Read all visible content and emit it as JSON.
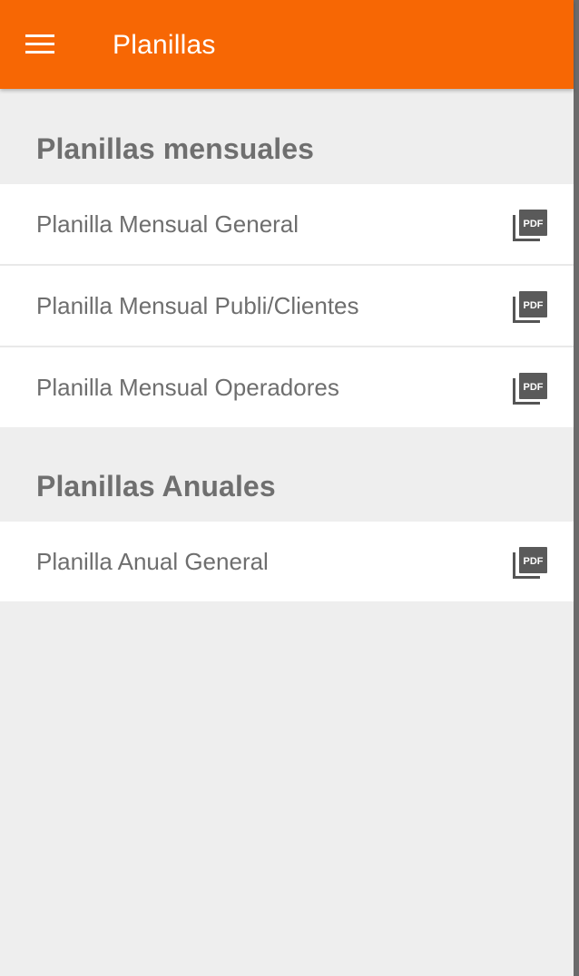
{
  "appbar": {
    "title": "Planillas",
    "menu_icon": "hamburger-menu-icon",
    "background_color": "#f76704"
  },
  "sections": [
    {
      "header": "Planillas mensuales",
      "items": [
        {
          "label": "Planilla Mensual General",
          "icon": "pdf-icon"
        },
        {
          "label": "Planilla Mensual Publi/Clientes",
          "icon": "pdf-icon"
        },
        {
          "label": "Planilla Mensual Operadores",
          "icon": "pdf-icon"
        }
      ]
    },
    {
      "header": "Planillas Anuales",
      "items": [
        {
          "label": "Planilla Anual General",
          "icon": "pdf-icon"
        }
      ]
    }
  ],
  "pdf_badge_text": "PDF",
  "colors": {
    "section_text": "#6f6f6f",
    "item_text": "#6e6e6e",
    "background": "#eeeeee"
  }
}
